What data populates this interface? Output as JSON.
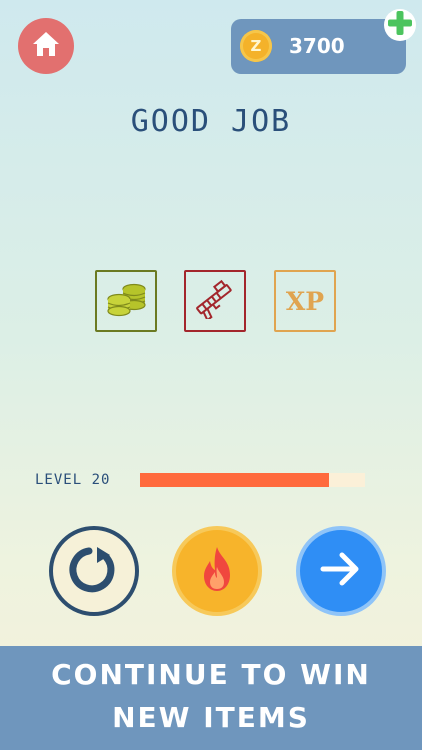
{
  "header": {
    "home_icon": "home-icon",
    "coin_symbol": "Z",
    "coin_amount": "3700",
    "add_icon": "plus-icon"
  },
  "headline": "GOOD JOB",
  "rewards": [
    {
      "name": "coins",
      "icon": "coin-stack-icon",
      "color": "#6b7a22"
    },
    {
      "name": "weapon",
      "icon": "weapon-icon",
      "color": "#a3262c"
    },
    {
      "name": "xp",
      "label": "XP",
      "color": "#e0a450"
    }
  ],
  "level": {
    "label": "LEVEL 20",
    "progress": 0.84
  },
  "actions": {
    "retry_icon": "retry-icon",
    "fire_icon": "fire-icon",
    "next_icon": "arrow-right-icon"
  },
  "banner": {
    "line1": "CONTINUE TO WIN",
    "line2": "NEW ITEMS"
  },
  "colors": {
    "accent_blue": "#6f96bd",
    "home_red": "#e2706f",
    "progress_orange": "#ff6a3d",
    "next_blue": "#2f8ef5"
  }
}
